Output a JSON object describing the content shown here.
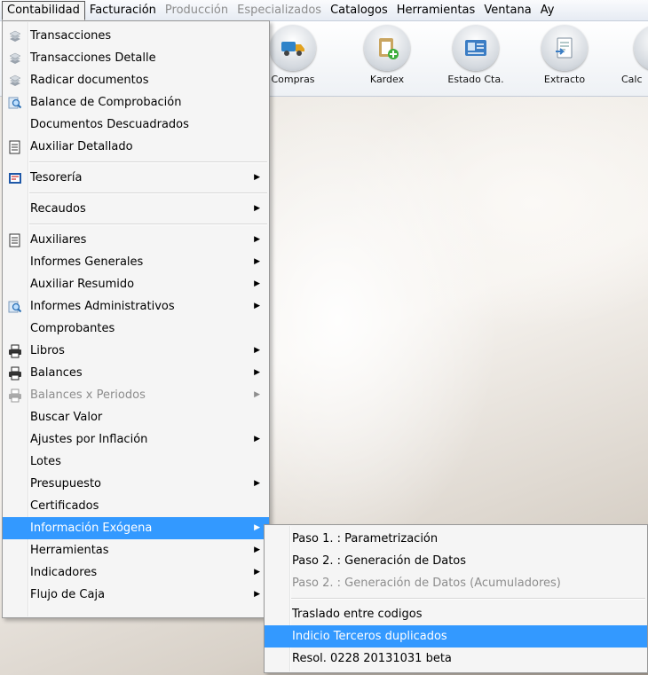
{
  "menubar": [
    "Contabilidad",
    "Facturación",
    "Producción",
    "Especializados",
    "Catalogos",
    "Herramientas",
    "Ventana",
    "Ay"
  ],
  "toolbar": [
    "Compras",
    "Kardex",
    "Estado Cta.",
    "Extracto",
    "Calc"
  ],
  "menu": {
    "transacciones": "Transacciones",
    "transacciones_detalle": "Transacciones Detalle",
    "radicar": "Radicar documentos",
    "balance_comprobacion": "Balance de Comprobación",
    "docs_descuadrados": "Documentos Descuadrados",
    "auxiliar_detallado": "Auxiliar Detallado",
    "tesoreria": "Tesorería",
    "recaudos": "Recaudos",
    "auxiliares": "Auxiliares",
    "informes_generales": "Informes Generales",
    "auxiliar_resumido": "Auxiliar Resumido",
    "informes_administrativos": "Informes Administrativos",
    "comprobantes": "Comprobantes",
    "libros": "Libros",
    "balances": "Balances",
    "balances_periodos": "Balances x Periodos",
    "buscar_valor": "Buscar Valor",
    "ajustes_inflacion": "Ajustes por Inflación",
    "lotes": "Lotes",
    "presupuesto": "Presupuesto",
    "certificados": "Certificados",
    "informacion_exogena": "Información Exógena",
    "herramientas": "Herramientas",
    "indicadores": "Indicadores",
    "flujo_caja": "Flujo de Caja"
  },
  "submenu": {
    "paso1": "Paso 1. : Parametrización",
    "paso2": "Paso 2. : Generación de Datos",
    "paso2_acum": "Paso 2. : Generación de Datos (Acumuladores)",
    "traslado": "Traslado entre codigos",
    "indicio": "Indicio Terceros duplicados",
    "resol": "Resol. 0228 20131031 beta"
  },
  "icons": {
    "transacciones": "stack-icon",
    "informes": "magnifier-icon",
    "auxiliar": "ledger-icon",
    "tesoreria": "treasury-icon",
    "libros": "printer-icon",
    "submenu": "submenu-arrow-icon"
  },
  "colors": {
    "highlight": "#3399ff",
    "disabled": "#8d8d8d",
    "menu_bg": "#f5f5f5"
  }
}
